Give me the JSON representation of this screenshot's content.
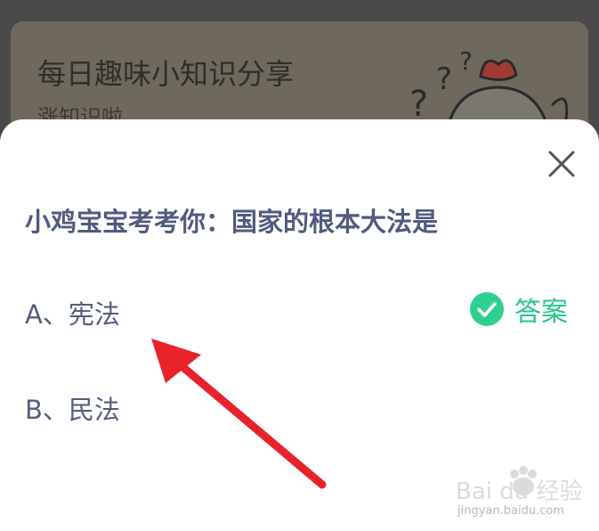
{
  "banner": {
    "title": "每日趣味小知识分享",
    "subtitle": "涨知识啦"
  },
  "quiz": {
    "question": "小鸡宝宝考考你：国家的根本大法是",
    "options": [
      {
        "label": "A、宪法",
        "correct": true
      },
      {
        "label": "B、民法",
        "correct": false
      }
    ],
    "answer_label": "答案",
    "answer_color": "#27c48a"
  },
  "watermark": {
    "logo_text": "Bai du 经验",
    "url": "jingyan.baidu.com"
  },
  "colors": {
    "question_text": "#525a7e",
    "annotation_arrow": "#e8222b"
  }
}
